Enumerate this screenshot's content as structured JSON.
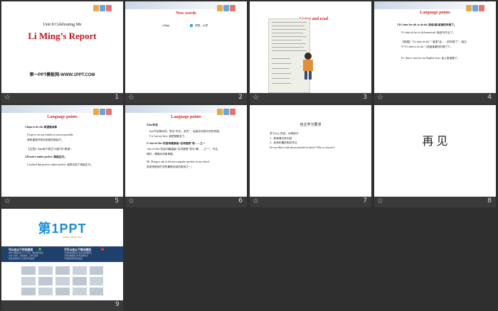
{
  "slides": [
    {
      "number": "1",
      "unit": "Unit 8  Celebrating  Me",
      "title": "Li Ming’s Report",
      "footer": "第一PPT模板网-WWW.1PPT.COM"
    },
    {
      "number": "2",
      "title": "New words",
      "word": "college",
      "meaning": "学院，大学"
    },
    {
      "number": "3",
      "title": "Listen and read"
    },
    {
      "number": "4",
      "title": "Language points",
      "lines": [
        "1.It’s time for sth. to do sth.   到该(做)某事的时候了。",
        "It’s time for her to do homework.   她该写作业了。",
        "【拓展】“It’s time for sth.” “某某”该……的时候了”，相当",
        "于“It’s time to do sth.” (该做某事的时候了)”。",
        "It’s time to start for our English class.  该上英语课了。"
      ]
    },
    {
      "number": "5",
      "title": "Language points",
      "lines": [
        "1.hope to do sth.    希望做某事",
        "I hope to see my friends as soon as possible.",
        "我希望能尽快见到我的朋友们。",
        "【注意】hope用于表达“可能”的“愿望”。",
        "2.Practice makes perfect.   熟能生巧。",
        "I realized that practice makes perfect.  我意识到了熟能生巧。"
      ]
    },
    {
      "number": "6",
      "title": "Language points",
      "lines": [
        "4.lose失去",
        "lose作及物动词，意为“失去，丢失”，后接名词或代词作宾语。",
        "I’ve lost my keys.  我把钥匙丢了。",
        "5.“one of+the+形容词最高级+名词复数”表……之一",
        "“one of+the+形容词最高级+名词复数”意为“最……之一”，作主",
        "语时，谓语动词用单数。",
        "Mr. Zhang is one of the most popular teachers in our school.",
        "张老师是我们学校最受欢迎的老师之一。"
      ]
    },
    {
      "number": "7",
      "title": "自主学习要求",
      "lines": [
        "学习以上内容，分两部分",
        "1、熟悉课文的内容",
        "2、老师布置的相关作业",
        "Do you like to talk about yourself to others? Why or why not?"
      ]
    },
    {
      "number": "8",
      "title": "再 见"
    },
    {
      "number": "9",
      "logo": "第1PPT",
      "slogan": "www.1ppt.com/",
      "left_heading": "可以在以下时间使用",
      "left_lines": [
        "本PPT模板可用于个人学习、教学课件展示",
        "可用于班会、主题演讲、工作汇报等",
        "非商业用途的个人项目均可使用"
      ],
      "right_heading": "不可以在以下情况使用",
      "right_lines": [
        "不得将本模板用于商业用途或转售",
        "不得将本模板上传至其他平台",
        "不得侵犯原创作者权益"
      ]
    }
  ]
}
